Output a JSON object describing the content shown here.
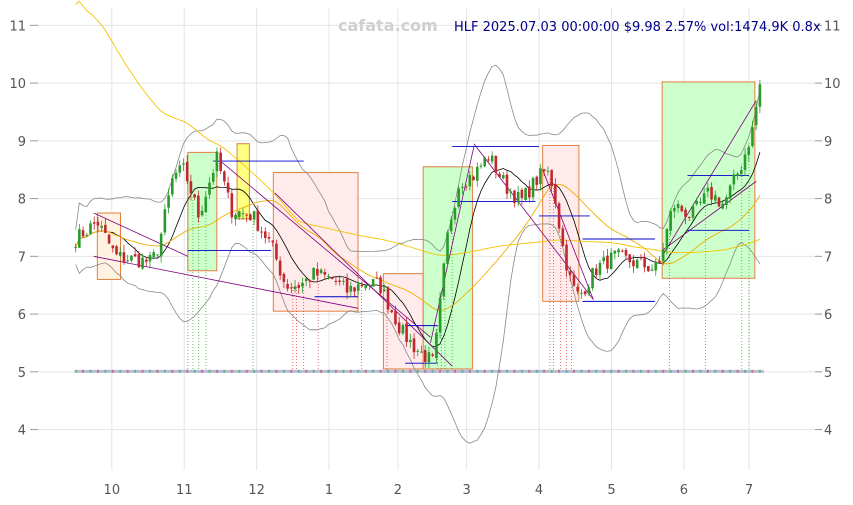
{
  "header": {
    "watermark": "cafata.com",
    "title": "HLF 2025.07.03 00:00:00 $9.98 2.57% vol:1474.9K 0.8x"
  },
  "chart_data": {
    "type": "candlestick",
    "ylim": [
      3.3,
      11.3
    ],
    "y_ticks": [
      4,
      5,
      6,
      7,
      8,
      9,
      10,
      11
    ],
    "x_ticks": [
      {
        "label": "10",
        "t": 0.5
      },
      {
        "label": "11",
        "t": 1.5
      },
      {
        "label": "12",
        "t": 2.5
      },
      {
        "label": "1",
        "t": 3.5
      },
      {
        "label": "2",
        "t": 4.45
      },
      {
        "label": "3",
        "t": 5.4
      },
      {
        "label": "4",
        "t": 6.4
      },
      {
        "label": "5",
        "t": 7.4
      },
      {
        "label": "6",
        "t": 8.4
      },
      {
        "label": "7",
        "t": 9.3
      }
    ],
    "t_range": [
      -0.05,
      9.7
    ],
    "grid": true,
    "price_anchors": [
      [
        0.0,
        7.3
      ],
      [
        0.3,
        7.6
      ],
      [
        0.55,
        7.0
      ],
      [
        0.8,
        6.95
      ],
      [
        1.05,
        6.9
      ],
      [
        1.15,
        7.2
      ],
      [
        1.35,
        8.4
      ],
      [
        1.5,
        8.5
      ],
      [
        1.7,
        7.7
      ],
      [
        1.95,
        8.7
      ],
      [
        2.15,
        7.8
      ],
      [
        2.45,
        7.7
      ],
      [
        2.7,
        7.2
      ],
      [
        2.9,
        6.5
      ],
      [
        3.1,
        6.5
      ],
      [
        3.3,
        6.7
      ],
      [
        3.55,
        6.6
      ],
      [
        3.75,
        6.4
      ],
      [
        4.0,
        6.55
      ],
      [
        4.2,
        6.5
      ],
      [
        4.5,
        5.7
      ],
      [
        4.7,
        5.4
      ],
      [
        4.95,
        5.15
      ],
      [
        5.0,
        5.8
      ],
      [
        5.15,
        7.5
      ],
      [
        5.3,
        8.3
      ],
      [
        5.5,
        8.4
      ],
      [
        5.7,
        8.75
      ],
      [
        5.95,
        8.2
      ],
      [
        6.15,
        7.95
      ],
      [
        6.35,
        8.3
      ],
      [
        6.5,
        8.5
      ],
      [
        6.6,
        8.2
      ],
      [
        6.72,
        7.2
      ],
      [
        6.85,
        6.5
      ],
      [
        6.95,
        6.3
      ],
      [
        7.2,
        6.8
      ],
      [
        7.45,
        7.0
      ],
      [
        7.7,
        6.9
      ],
      [
        7.95,
        6.8
      ],
      [
        8.05,
        6.8
      ],
      [
        8.25,
        7.9
      ],
      [
        8.5,
        7.7
      ],
      [
        8.75,
        8.1
      ],
      [
        8.95,
        7.9
      ],
      [
        9.2,
        8.6
      ],
      [
        9.35,
        9.2
      ],
      [
        9.45,
        9.98
      ]
    ],
    "rectangles": [
      {
        "t1": 0.3,
        "t2": 0.62,
        "y1": 6.6,
        "y2": 7.75,
        "fill": "#fff2e0",
        "stroke": "#e08040"
      },
      {
        "t1": 1.55,
        "t2": 1.95,
        "y1": 6.75,
        "y2": 8.8,
        "fill": "#ccffcc",
        "stroke": "#e08040"
      },
      {
        "t1": 2.23,
        "t2": 2.4,
        "y1": 7.65,
        "y2": 8.95,
        "fill": "#ffff80",
        "stroke": "#e08040"
      },
      {
        "t1": 2.73,
        "t2": 3.9,
        "y1": 6.05,
        "y2": 8.45,
        "fill": "#ffebeb",
        "stroke": "#e08040"
      },
      {
        "t1": 4.25,
        "t2": 4.8,
        "y1": 5.05,
        "y2": 6.7,
        "fill": "#ffebeb",
        "stroke": "#e08040"
      },
      {
        "t1": 4.8,
        "t2": 5.48,
        "y1": 5.05,
        "y2": 8.55,
        "fill": "#ccffcc",
        "stroke": "#e08040"
      },
      {
        "t1": 6.45,
        "t2": 6.95,
        "y1": 6.22,
        "y2": 8.92,
        "fill": "#ffebeb",
        "stroke": "#e08040"
      },
      {
        "t1": 8.1,
        "t2": 9.38,
        "y1": 6.62,
        "y2": 10.02,
        "fill": "#ccffcc",
        "stroke": "#e08040"
      }
    ],
    "hlines": [
      {
        "t1": 1.55,
        "t2": 2.7,
        "y": 7.1
      },
      {
        "t1": 1.9,
        "t2": 3.15,
        "y": 8.65
      },
      {
        "t1": 3.3,
        "t2": 3.9,
        "y": 6.3
      },
      {
        "t1": 4.55,
        "t2": 5.0,
        "y": 5.8
      },
      {
        "t1": 4.55,
        "t2": 5.0,
        "y": 5.15
      },
      {
        "t1": 5.2,
        "t2": 6.4,
        "y": 8.9
      },
      {
        "t1": 5.2,
        "t2": 6.35,
        "y": 7.95
      },
      {
        "t1": 6.4,
        "t2": 7.1,
        "y": 7.7
      },
      {
        "t1": 7.0,
        "t2": 8.0,
        "y": 7.3
      },
      {
        "t1": 7.0,
        "t2": 8.0,
        "y": 6.22
      },
      {
        "t1": 8.45,
        "t2": 9.3,
        "y": 8.4
      },
      {
        "t1": 8.45,
        "t2": 9.3,
        "y": 7.45
      }
    ],
    "trend_lines": [
      {
        "t1": 0.25,
        "y1": 7.75,
        "t2": 1.55,
        "y2": 7.0
      },
      {
        "t1": 0.25,
        "y1": 7.0,
        "t2": 3.9,
        "y2": 6.1
      },
      {
        "t1": 2.0,
        "y1": 8.65,
        "t2": 4.9,
        "y2": 5.6
      },
      {
        "t1": 2.75,
        "y1": 8.1,
        "t2": 5.2,
        "y2": 5.1
      },
      {
        "t1": 4.9,
        "y1": 5.5,
        "t2": 5.5,
        "y2": 8.9
      },
      {
        "t1": 6.45,
        "y1": 8.5,
        "t2": 7.15,
        "y2": 6.25
      },
      {
        "t1": 5.5,
        "y1": 8.95,
        "t2": 7.15,
        "y2": 6.25
      },
      {
        "t1": 8.1,
        "y1": 7.0,
        "t2": 9.4,
        "y2": 9.7
      },
      {
        "t1": 8.1,
        "y1": 7.1,
        "t2": 9.4,
        "y2": 8.3
      }
    ],
    "vmarks_green": [
      1.55,
      1.62,
      1.7,
      1.8,
      2.45,
      5.0,
      5.05,
      5.1,
      5.2,
      8.2,
      8.7,
      9.2,
      9.3
    ],
    "vmarks_red": [
      3.0,
      3.05,
      3.15,
      3.35,
      3.95,
      4.3,
      6.55,
      6.6,
      6.7,
      6.78,
      6.85
    ]
  }
}
